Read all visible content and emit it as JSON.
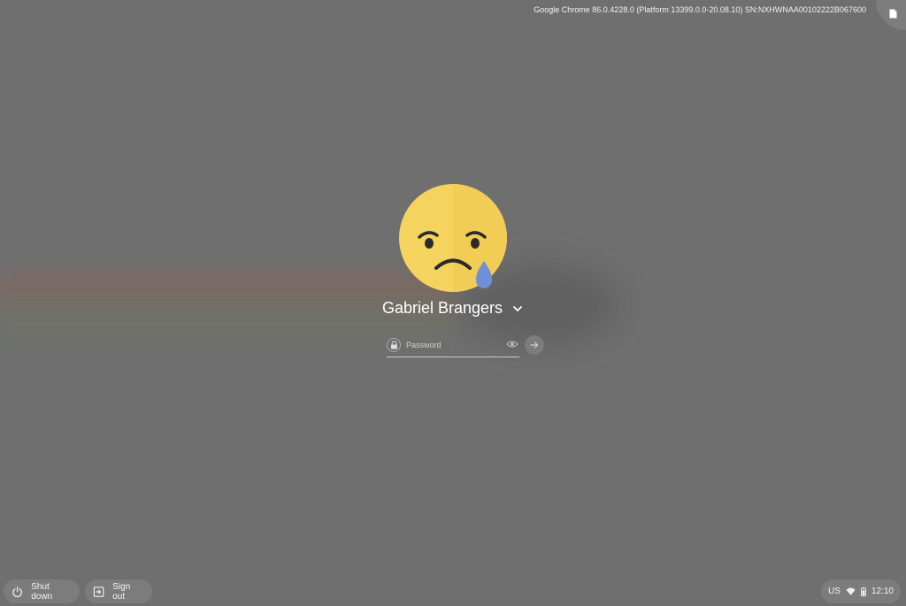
{
  "header": {
    "version_info": "Google Chrome 86.0.4228.0 (Platform 13399.0.0-20.08.10) SN:NXHWNAA00102222B067600",
    "corner_icon": "document-icon"
  },
  "user": {
    "name": "Gabriel Brangers",
    "avatar_icon": "crying-face-icon"
  },
  "password": {
    "value": "",
    "placeholder": "Password"
  },
  "shelf": {
    "shutdown_label": "Shut down",
    "signout_label": "Sign out"
  },
  "status_tray": {
    "ime": "US",
    "time": "12:10"
  },
  "colors": {
    "background": "#6f6f6f",
    "avatar_face": "#f4d35e",
    "tear": "#6f8fd6",
    "pill": "#7c7c7c"
  }
}
